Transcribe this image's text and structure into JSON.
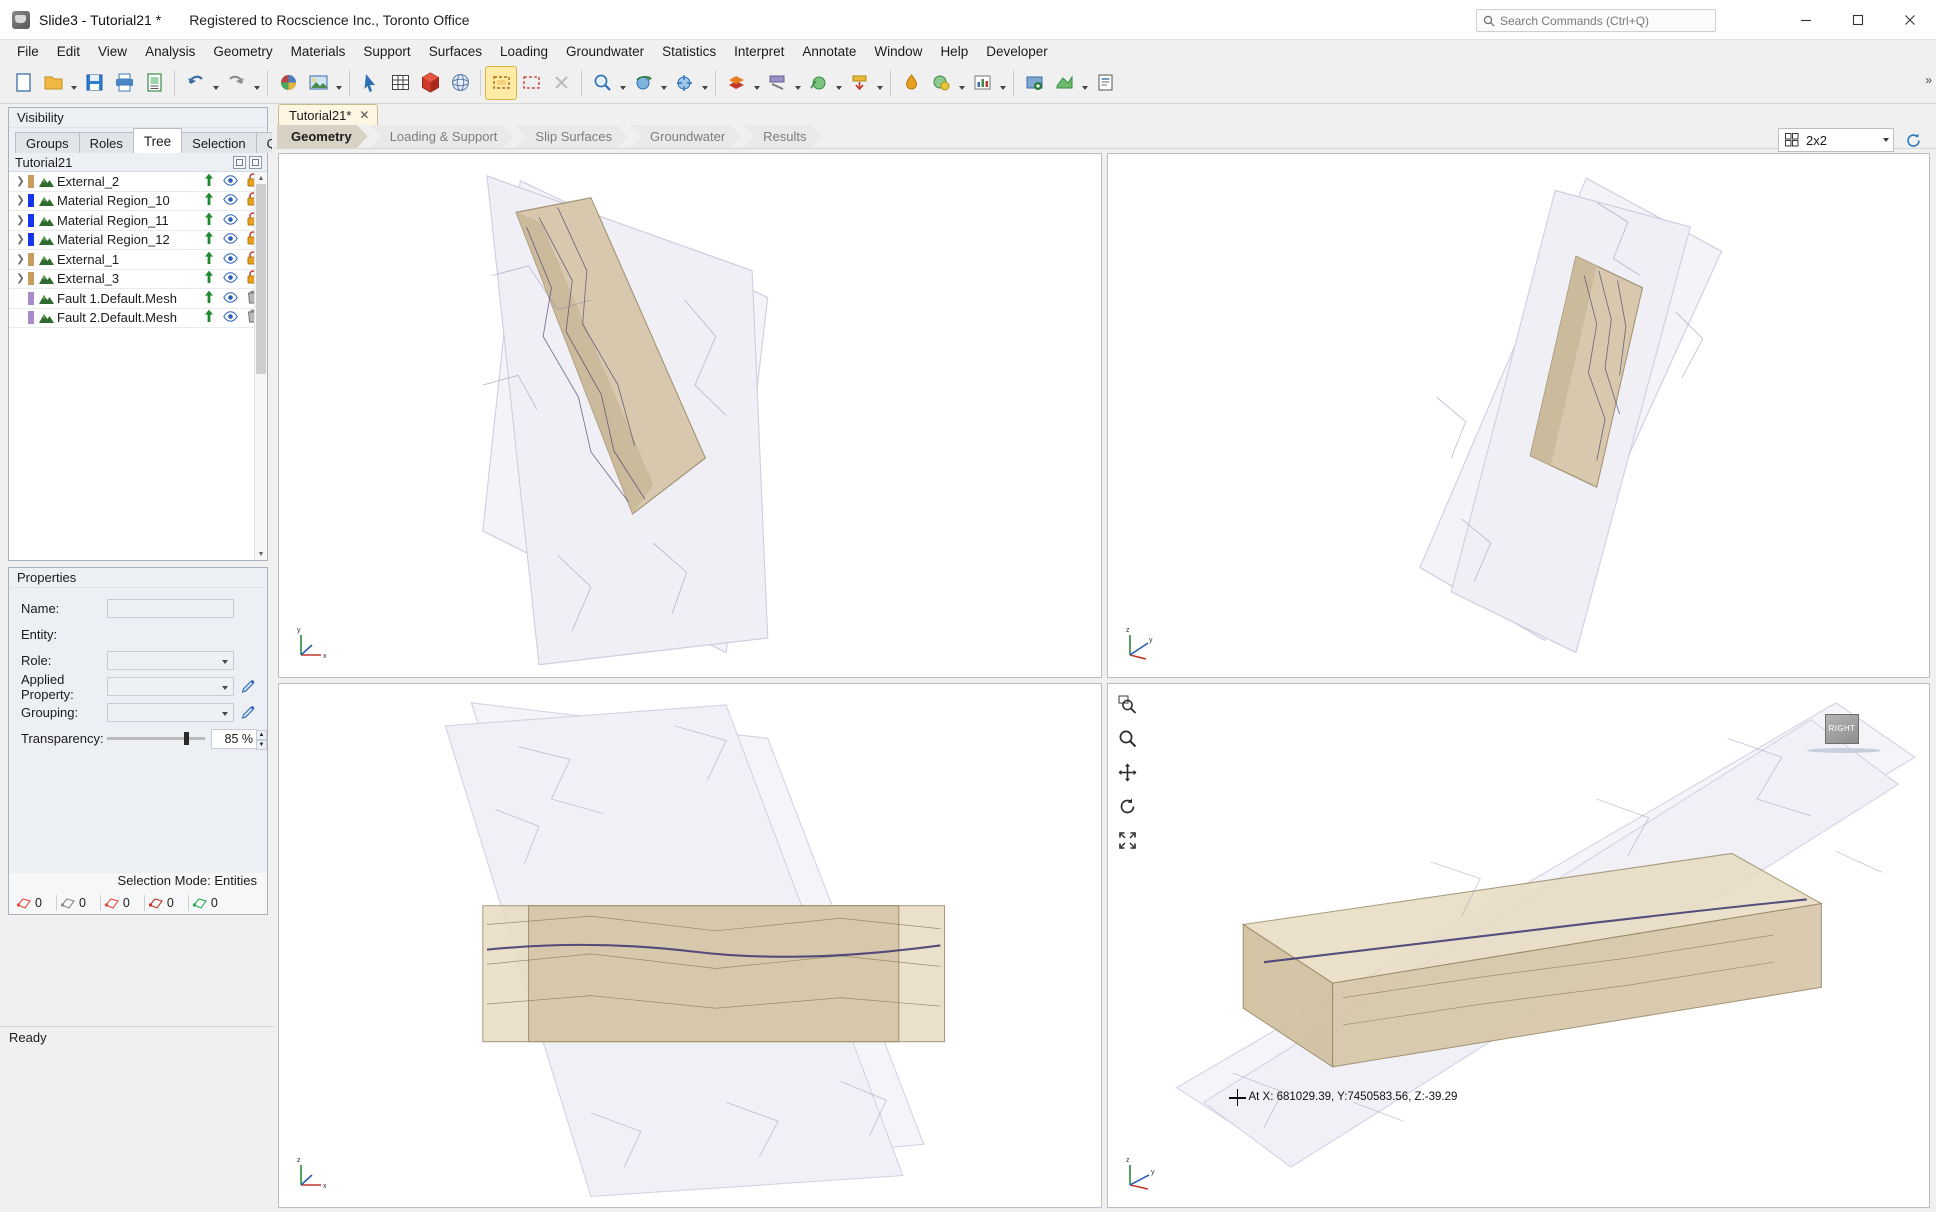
{
  "titlebar": {
    "title": "Slide3 - Tutorial21 *",
    "registration": "Registered to Rocscience Inc., Toronto Office",
    "search_placeholder": "Search Commands (Ctrl+Q)",
    "minimize": "─",
    "maximize": "☐",
    "close": "✕"
  },
  "menubar": {
    "items": [
      {
        "label": "File"
      },
      {
        "label": "Edit"
      },
      {
        "label": "View"
      },
      {
        "label": "Analysis"
      },
      {
        "label": "Geometry"
      },
      {
        "label": "Materials"
      },
      {
        "label": "Support"
      },
      {
        "label": "Surfaces"
      },
      {
        "label": "Loading"
      },
      {
        "label": "Groundwater"
      },
      {
        "label": "Statistics"
      },
      {
        "label": "Interpret"
      },
      {
        "label": "Annotate"
      },
      {
        "label": "Window"
      },
      {
        "label": "Help"
      },
      {
        "label": "Developer"
      }
    ]
  },
  "toolbar": {
    "overflow": "»",
    "buttons": [
      {
        "name": "new-file",
        "icon": "new-document-icon"
      },
      {
        "name": "open-file",
        "icon": "open-folder-icon",
        "dropdown": true
      },
      {
        "name": "save-file",
        "icon": "save-disk-icon"
      },
      {
        "name": "print",
        "icon": "printer-icon"
      },
      {
        "name": "page-setup",
        "icon": "page-setup-icon"
      },
      {
        "name": "undo",
        "icon": "undo-arrow-icon",
        "dropdown": true
      },
      {
        "name": "redo",
        "icon": "redo-arrow-icon",
        "dropdown": true
      },
      {
        "name": "color-palette",
        "icon": "color-wheel-icon"
      },
      {
        "name": "image-capture",
        "icon": "picture-icon",
        "dropdown": true
      },
      {
        "name": "select-pointer",
        "icon": "cursor-arrow-icon"
      },
      {
        "name": "grid-table",
        "icon": "table-grid-icon"
      },
      {
        "name": "solid-model",
        "icon": "red-cube-icon"
      },
      {
        "name": "mesh-view",
        "icon": "mesh-sphere-icon"
      },
      {
        "name": "rectangle-select",
        "icon": "dashed-rectangle-icon",
        "active": true
      },
      {
        "name": "window-select",
        "icon": "window-select-icon"
      },
      {
        "name": "delete-selection",
        "icon": "delete-x-icon"
      },
      {
        "name": "zoom-tool",
        "icon": "magnifier-icon",
        "dropdown": true
      },
      {
        "name": "rotate-view",
        "icon": "rotate-sphere-icon",
        "dropdown": true
      },
      {
        "name": "pan-view",
        "icon": "pan-hand-icon",
        "dropdown": true
      },
      {
        "name": "add-material",
        "icon": "material-layer-icon",
        "dropdown": true
      },
      {
        "name": "add-support",
        "icon": "support-bolt-icon",
        "dropdown": true
      },
      {
        "name": "add-slip-surface",
        "icon": "slip-surface-icon",
        "dropdown": true
      },
      {
        "name": "add-loading",
        "icon": "loading-arrow-icon",
        "dropdown": true
      },
      {
        "name": "groundwater-tool",
        "icon": "water-drop-icon"
      },
      {
        "name": "statistics-tool",
        "icon": "statistics-icon",
        "dropdown": true
      },
      {
        "name": "chart-tool",
        "icon": "bar-chart-icon",
        "dropdown": true
      },
      {
        "name": "compute",
        "icon": "compute-gear-icon"
      },
      {
        "name": "interpret",
        "icon": "interpret-icon",
        "dropdown": true
      },
      {
        "name": "report",
        "icon": "report-icon"
      }
    ]
  },
  "left_panel": {
    "visibility_caption": "Visibility",
    "tabs": [
      {
        "label": "Groups",
        "active": false
      },
      {
        "label": "Roles",
        "active": false
      },
      {
        "label": "Tree",
        "active": true
      },
      {
        "label": "Selection",
        "active": false
      },
      {
        "label": "Query",
        "active": false
      }
    ],
    "tree_root": "Tutorial21",
    "tree_items": [
      {
        "label": "External_2",
        "swatch": "#c89b5e",
        "expandable": true,
        "lock": true
      },
      {
        "label": "Material Region_10",
        "swatch": "#1635ef",
        "expandable": true,
        "lock": true
      },
      {
        "label": "Material Region_11",
        "swatch": "#1635ef",
        "expandable": true,
        "lock": true
      },
      {
        "label": "Material Region_12",
        "swatch": "#1635ef",
        "expandable": true,
        "lock": true
      },
      {
        "label": "External_1",
        "swatch": "#c89b5e",
        "expandable": true,
        "lock": true
      },
      {
        "label": "External_3",
        "swatch": "#c89b5e",
        "expandable": true,
        "lock": true
      },
      {
        "label": "Fault 1.Default.Mesh",
        "swatch": "#a78ccb",
        "expandable": false,
        "lock": false
      },
      {
        "label": "Fault 2.Default.Mesh",
        "swatch": "#a78ccb",
        "expandable": false,
        "lock": false
      }
    ]
  },
  "properties": {
    "caption": "Properties",
    "fields": [
      {
        "label": "Name:",
        "type": "input",
        "value": ""
      },
      {
        "label": "Entity:",
        "type": "text",
        "value": ""
      },
      {
        "label": "Role:",
        "type": "combo",
        "value": ""
      },
      {
        "label": "Applied Property:",
        "type": "combo",
        "value": "",
        "pencil": true
      },
      {
        "label": "Grouping:",
        "type": "combo",
        "value": "",
        "pencil": true
      }
    ],
    "transparency_label": "Transparency:",
    "transparency_value": "85 %",
    "selection_mode": "Selection Mode: Entities",
    "counts": [
      {
        "name": "vertex-count",
        "icon": "vertex-icon",
        "value": "0",
        "color": "#e84a3a"
      },
      {
        "name": "edge-count",
        "icon": "edge-icon",
        "value": "0",
        "color": "#8a8a8a"
      },
      {
        "name": "face-count",
        "icon": "face-icon",
        "value": "0",
        "color": "#e84a3a"
      },
      {
        "name": "solid-count",
        "icon": "solid-icon",
        "value": "0",
        "color": "#c0392b"
      },
      {
        "name": "entity-count",
        "icon": "entity-icon",
        "value": "0",
        "color": "#2aa85a"
      }
    ]
  },
  "document": {
    "tab_label": "Tutorial21*",
    "tab_close": "✕",
    "workflow_steps": [
      {
        "label": "Geometry",
        "active": true
      },
      {
        "label": "Loading & Support",
        "active": false
      },
      {
        "label": "Slip Surfaces",
        "active": false
      },
      {
        "label": "Groundwater",
        "active": false
      },
      {
        "label": "Results",
        "active": false
      }
    ],
    "layout_value": "2x2",
    "layout_icon": "grid-2x2-icon",
    "refresh_icon": "refresh-icon"
  },
  "viewports": {
    "nav_tools": [
      {
        "name": "zoom-window-tool",
        "icon": "zoom-window-icon"
      },
      {
        "name": "zoom-tool",
        "icon": "magnifier-icon"
      },
      {
        "name": "pan-tool",
        "icon": "pan-move-icon"
      },
      {
        "name": "rotate-tool",
        "icon": "rotate-ccw-icon"
      },
      {
        "name": "zoom-all-tool",
        "icon": "zoom-extents-icon"
      }
    ],
    "view_cube_label": "RIGHT",
    "coordinate_annotation": "At X: 681029.39, Y:7450583.56, Z:-39.29",
    "axis_labels": {
      "x": "x",
      "y": "y",
      "z": "z"
    }
  },
  "statusbar": {
    "text": "Ready"
  },
  "colors": {
    "accent": "#d7d2c4",
    "tab_active": "#ffffff",
    "doc_tab": "#fdf6e3",
    "toolbar_active": "#ffeaa6",
    "panel_bg": "#eceff3",
    "rock_fill": "#d6c6a8",
    "slip_plane": "#e7e6f2"
  }
}
